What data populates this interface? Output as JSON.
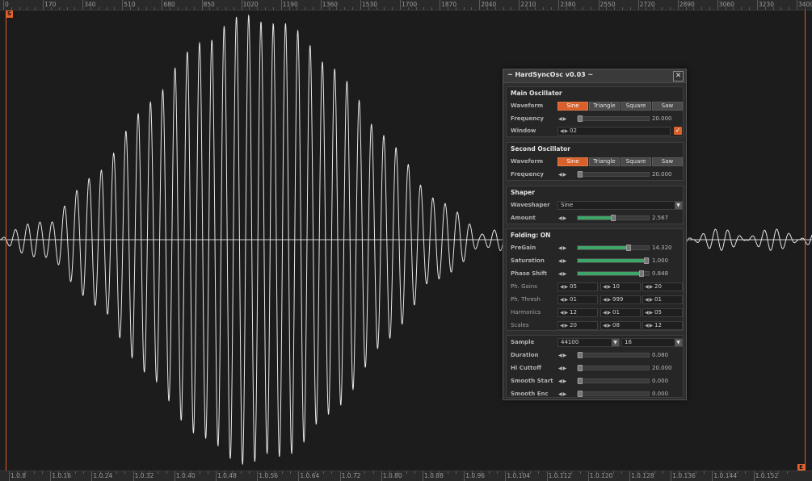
{
  "ruler_top": {
    "labels": [
      "0",
      "170",
      "340",
      "510",
      "680",
      "850",
      "1020",
      "1190",
      "1360",
      "1530",
      "1700",
      "1870",
      "2040",
      "2210",
      "2380",
      "2550",
      "2720",
      "2890",
      "3060",
      "3230",
      "3400"
    ]
  },
  "ruler_bottom": {
    "labels": [
      "1.0.8",
      "1.0.16",
      "1.0.24",
      "1.0.32",
      "1.0.40",
      "1.0.48",
      "1.0.56",
      "1.0.64",
      "1.0.72",
      "1.0.80",
      "1.0.88",
      "1.0.96",
      "1.0.104",
      "1.0.112",
      "1.0.120",
      "1.0.128",
      "1.0.136",
      "1.0.144",
      "1.0.152"
    ]
  },
  "markers": {
    "start_label": "S",
    "end_label": "E",
    "color": "#d8602a"
  },
  "panel": {
    "title": "~ HardSyncOsc v0.03 ~",
    "close_glyph": "✕",
    "main_osc": {
      "title": "Main Oscillator",
      "waveform_label": "Waveform",
      "waveforms": [
        "Sine",
        "Triangle",
        "Square",
        "Saw"
      ],
      "selected": "Sine",
      "frequency_label": "Frequency",
      "frequency_value": "20.000",
      "frequency_level": 0.0,
      "window_label": "Window",
      "window_value": "02",
      "window_checked": true
    },
    "second_osc": {
      "title": "Second Oscillator",
      "waveform_label": "Waveform",
      "waveforms": [
        "Sine",
        "Triangle",
        "Square",
        "Saw"
      ],
      "selected": "Sine",
      "frequency_label": "Frequency",
      "frequency_value": "20.000",
      "frequency_level": 0.0
    },
    "shaper": {
      "title": "Shaper",
      "waveshaper_label": "Waveshaper",
      "waveshaper_value": "Sine",
      "amount_label": "Amount",
      "amount_value": "2.567",
      "amount_level": 0.5
    },
    "folding": {
      "title": "Folding: ON",
      "pregain_label": "PreGain",
      "pregain_value": "14.320",
      "pregain_level": 0.72,
      "saturation_label": "Saturation",
      "saturation_value": "1.000",
      "saturation_level": 1.0,
      "phase_label": "Phase Shift",
      "phase_value": "0.848",
      "phase_level": 0.9,
      "gains_label": "Ph. Gains",
      "gains": [
        "05",
        "10",
        "20"
      ],
      "thresh_label": "Ph. Thresh",
      "thresh": [
        "01",
        "999",
        "01"
      ],
      "harmonics_label": "Harmonics",
      "harmonics": [
        "12",
        "01",
        "05"
      ],
      "scales_label": "Scales",
      "scales": [
        "20",
        "08",
        "12"
      ]
    },
    "output": {
      "sample_label": "Sample",
      "sample_rate": "44100",
      "bit_depth": "16",
      "duration_label": "Duration",
      "duration_value": "0.080",
      "hicut_label": "Hi Cuttoff",
      "hicut_value": "20.000",
      "smooth_start_label": "Smooth Start",
      "smooth_start_value": "0.000",
      "smooth_end_label": "Smooth Enc",
      "smooth_end_value": "0.000"
    }
  }
}
